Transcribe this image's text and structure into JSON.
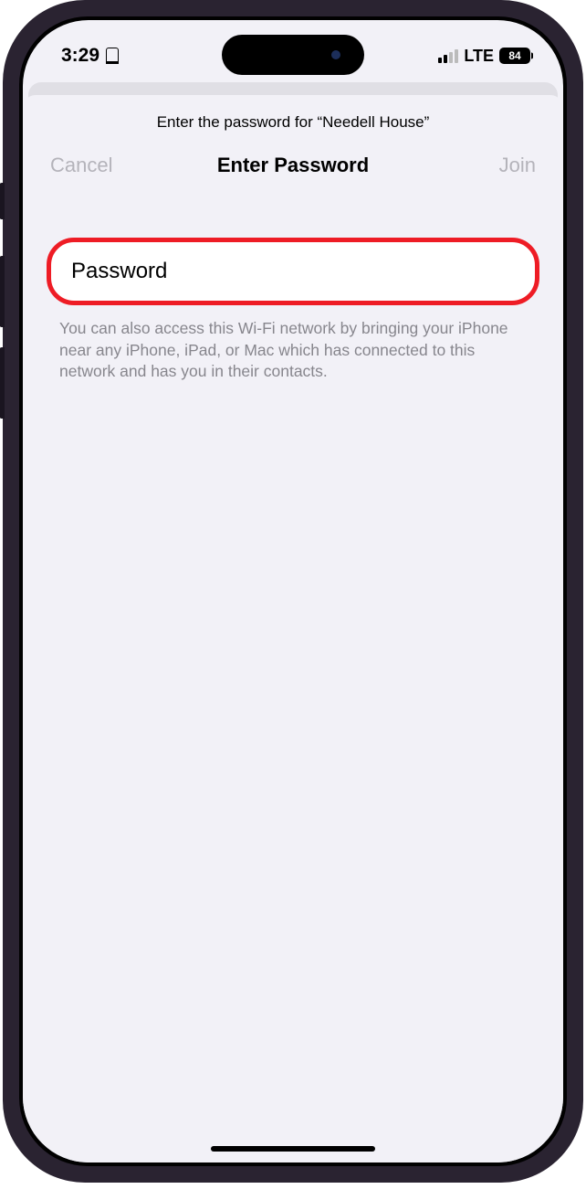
{
  "status_bar": {
    "time": "3:29",
    "network_type": "LTE",
    "battery_percent": "84"
  },
  "sheet": {
    "subtitle": "Enter the password for “Needell House”",
    "cancel_label": "Cancel",
    "title": "Enter Password",
    "join_label": "Join"
  },
  "password_field": {
    "placeholder": "Password",
    "value": ""
  },
  "help_text": "You can also access this Wi-Fi network by bringing your iPhone near any iPhone, iPad, or Mac which has connected to this network and has you in their contacts."
}
